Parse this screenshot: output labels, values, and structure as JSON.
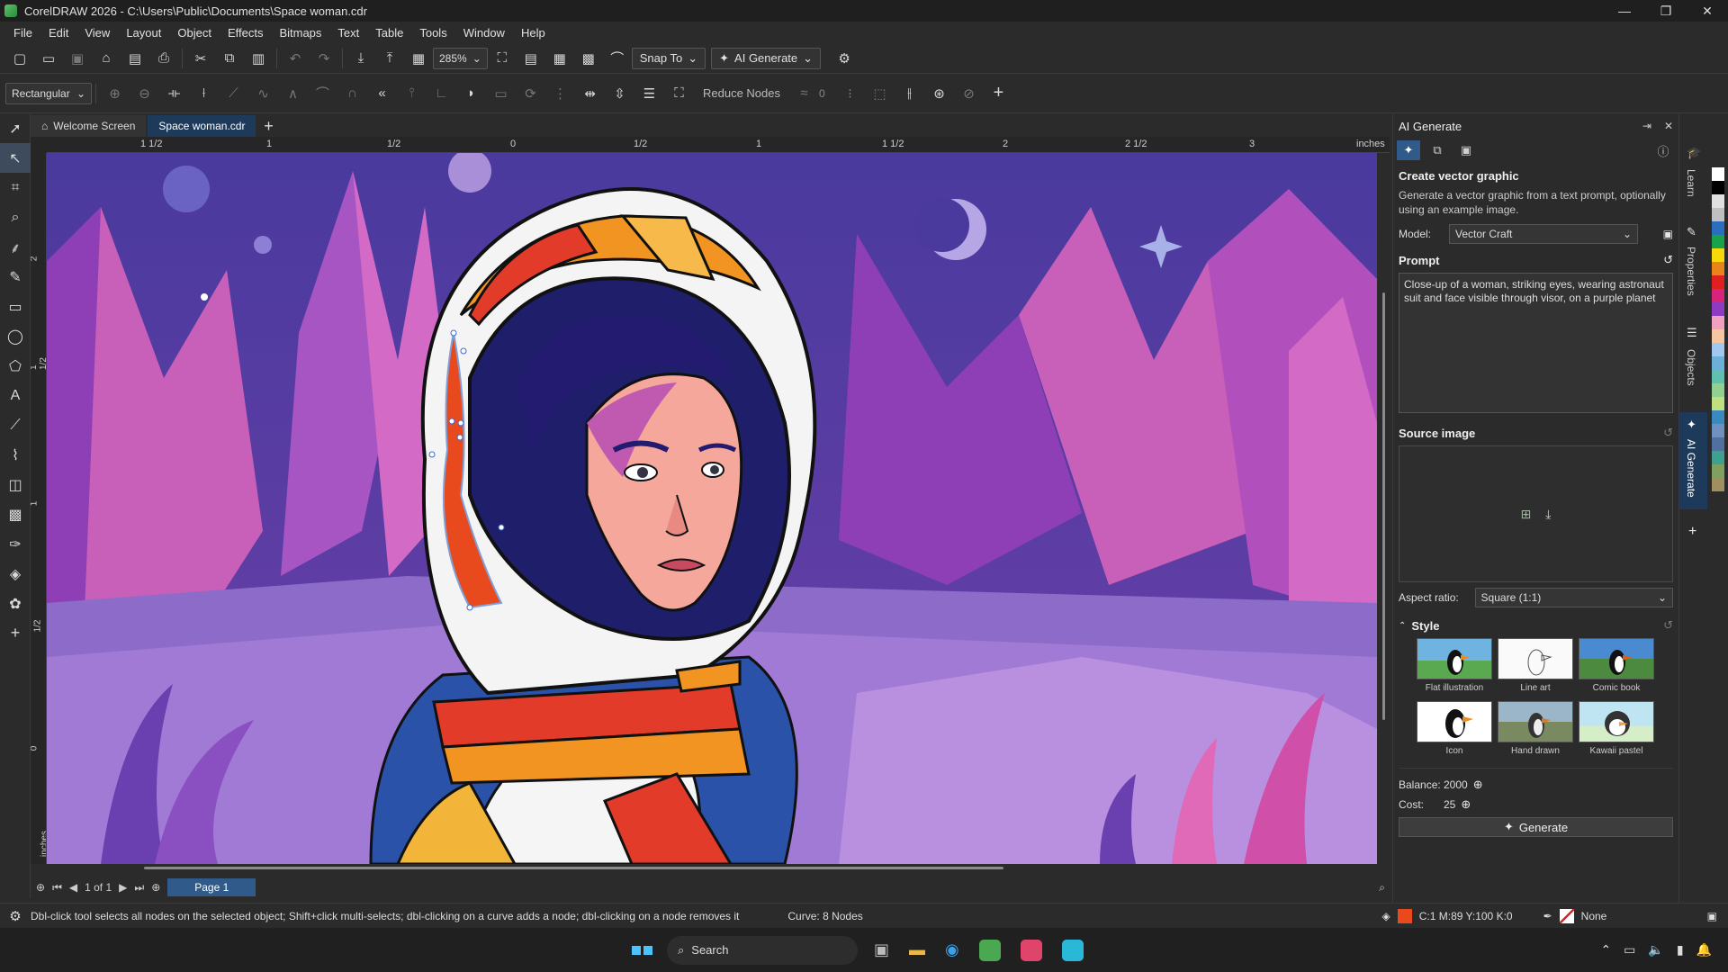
{
  "window": {
    "title": "CorelDRAW 2026 - C:\\Users\\Public\\Documents\\Space woman.cdr",
    "minimize": "—",
    "maximize": "❐",
    "close": "✕"
  },
  "menu": [
    "File",
    "Edit",
    "View",
    "Layout",
    "Object",
    "Effects",
    "Bitmaps",
    "Text",
    "Table",
    "Tools",
    "Window",
    "Help"
  ],
  "toolbar": {
    "zoom": "285%",
    "snap_to": "Snap To",
    "ai_generate": "AI Generate"
  },
  "property_bar": {
    "selection_mode": "Rectangular",
    "reduce_nodes": "Reduce Nodes",
    "smoothing": "0"
  },
  "tabs": {
    "welcome": "Welcome Screen",
    "document": "Space woman.cdr",
    "add": "+"
  },
  "ruler": {
    "h_labels": [
      "1 1/2",
      "1",
      "1/2",
      "0",
      "1/2",
      "1",
      "1 1/2",
      "2",
      "2 1/2",
      "3",
      "inches"
    ],
    "v_labels": [
      "2",
      "1 1/2",
      "1",
      "1/2",
      "0",
      "inches"
    ]
  },
  "page_nav": {
    "count": "1 of 1",
    "page": "Page 1"
  },
  "status": {
    "hint": "Dbl-click tool selects all nodes on the selected object; Shift+click multi-selects; dbl-clicking on a curve adds a node; dbl-clicking on a node removes it",
    "curve_info": "Curve: 8 Nodes",
    "fill": "C:1 M:89 Y:100 K:0",
    "fill_color": "#e84a1e",
    "outline": "None"
  },
  "panel": {
    "title": "AI Generate",
    "heading": "Create vector graphic",
    "description": "Generate a vector graphic from a text prompt, optionally using an example image.",
    "model_label": "Model:",
    "model_value": "Vector Craft",
    "prompt_label": "Prompt",
    "prompt_text": "Close-up of a woman, striking eyes, wearing astronaut suit and face visible through visor, on a purple planet",
    "source_label": "Source image",
    "aspect_label": "Aspect ratio:",
    "aspect_value": "Square (1:1)",
    "style_label": "Style",
    "styles": [
      "Flat illustration",
      "Line art",
      "Comic book",
      "Icon",
      "Hand drawn",
      "Kawaii pastel"
    ],
    "balance_label": "Balance:",
    "balance_value": "2000",
    "cost_label": "Cost:",
    "cost_value": "25",
    "generate": "Generate"
  },
  "dockers": [
    "Learn",
    "Properties",
    "Objects",
    "AI Generate"
  ],
  "taskbar": {
    "search": "Search"
  },
  "palette_colors": [
    "#ffffff",
    "#000000",
    "#e0e0e0",
    "#c0c0c0",
    "#2a6ebd",
    "#17a34a",
    "#f5d90a",
    "#e8841a",
    "#e02020",
    "#d6247a",
    "#8e3bc2",
    "#f0a0c0",
    "#f5c6a0",
    "#a0c8f0",
    "#6ab0d8",
    "#60c0b0",
    "#90d090",
    "#c0e080",
    "#3a8ac0",
    "#7090c0",
    "#5070a0",
    "#40a090",
    "#80a060",
    "#a09060"
  ]
}
